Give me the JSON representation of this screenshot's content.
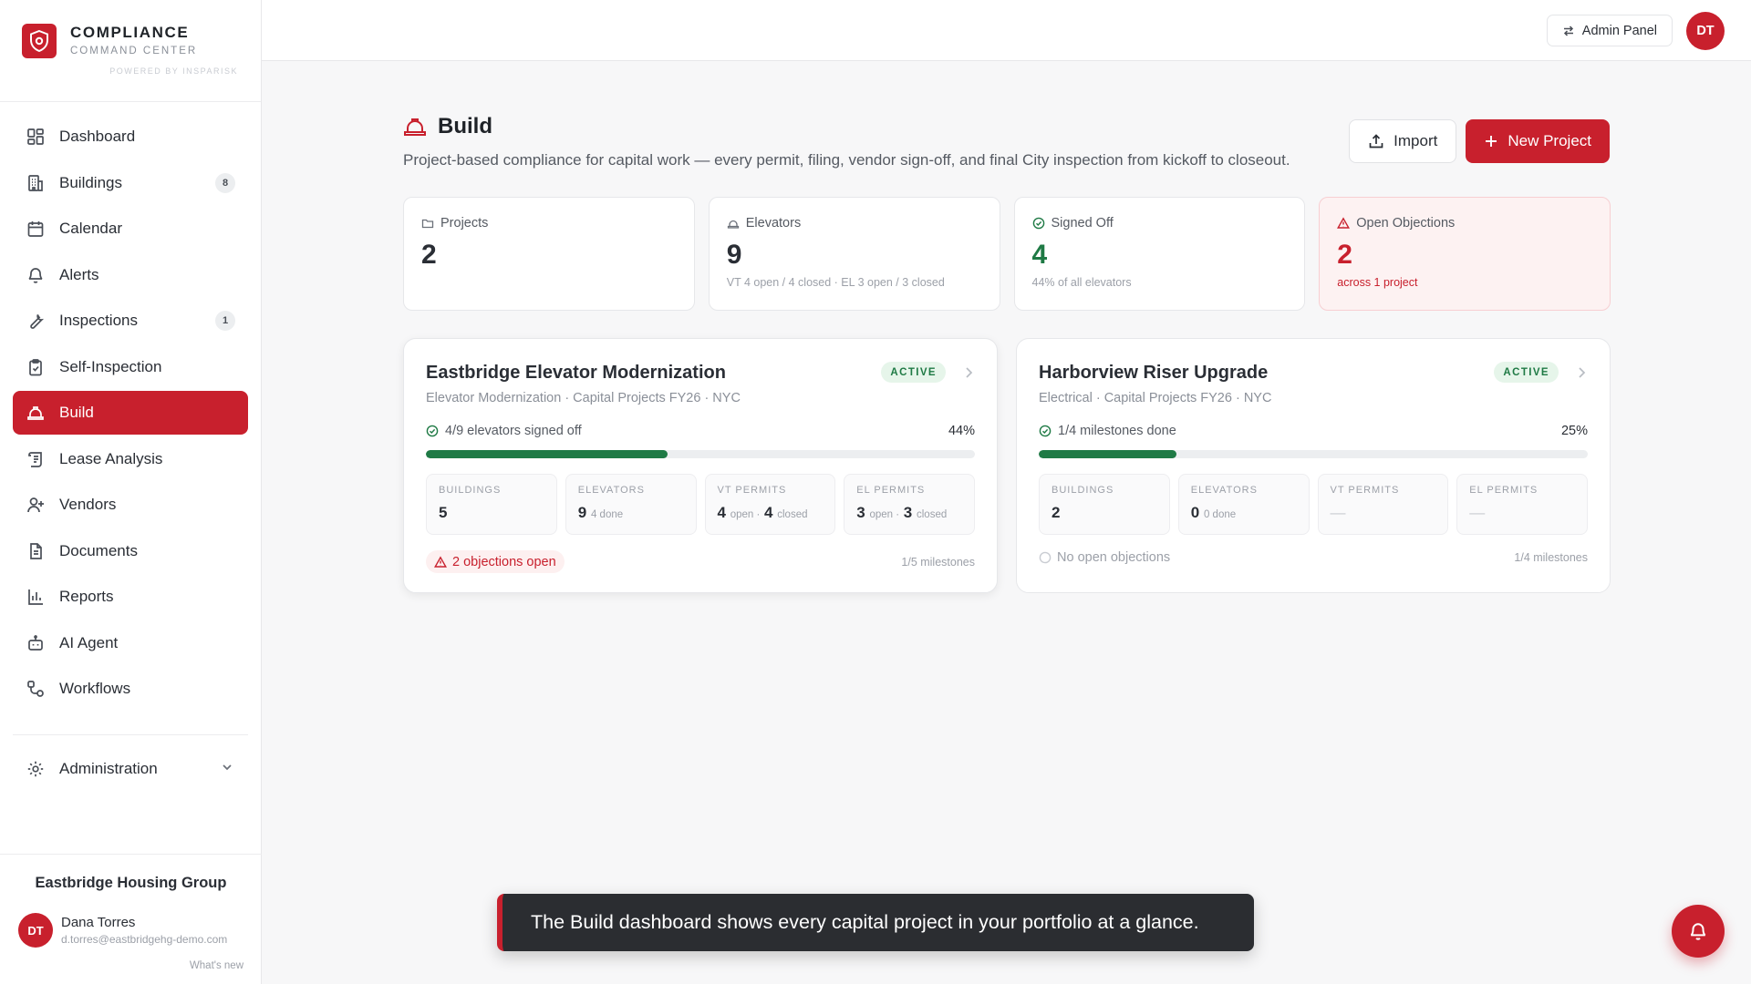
{
  "brand": {
    "title": "COMPLIANCE",
    "subtitle": "COMMAND CENTER",
    "powered": "POWERED BY INSPARISK"
  },
  "nav": {
    "items": [
      {
        "label": "Dashboard",
        "icon": "dashboard-icon"
      },
      {
        "label": "Buildings",
        "icon": "building-icon",
        "badge": "8"
      },
      {
        "label": "Calendar",
        "icon": "calendar-icon"
      },
      {
        "label": "Alerts",
        "icon": "bell-icon"
      },
      {
        "label": "Inspections",
        "icon": "wrench-icon",
        "badge": "1"
      },
      {
        "label": "Self-Inspection",
        "icon": "clipboard-icon"
      },
      {
        "label": "Build",
        "icon": "hardhat-icon",
        "active": true
      },
      {
        "label": "Lease Analysis",
        "icon": "scroll-icon"
      },
      {
        "label": "Vendors",
        "icon": "user-plus-icon"
      },
      {
        "label": "Documents",
        "icon": "document-icon"
      },
      {
        "label": "Reports",
        "icon": "bar-chart-icon"
      },
      {
        "label": "AI Agent",
        "icon": "bot-icon"
      },
      {
        "label": "Workflows",
        "icon": "workflow-icon"
      }
    ],
    "admin_label": "Administration"
  },
  "footer": {
    "org": "Eastbridge Housing Group",
    "user_initials": "DT",
    "user_name": "Dana Torres",
    "user_email": "d.torres@eastbridgehg-demo.com",
    "whats_new": "What's new"
  },
  "topbar": {
    "admin_panel": "Admin Panel",
    "avatar_initials": "DT"
  },
  "page": {
    "title": "Build",
    "description": "Project-based compliance for capital work — every permit, filing, vendor sign-off, and final City inspection from kickoff to closeout.",
    "import_label": "Import",
    "new_project_label": "New Project"
  },
  "stats": [
    {
      "label": "Projects",
      "value": "2",
      "sub": ""
    },
    {
      "label": "Elevators",
      "value": "9",
      "sub": "VT 4 open / 4 closed · EL 3 open / 3 closed"
    },
    {
      "label": "Signed Off",
      "value": "4",
      "sub": "44% of all elevators"
    },
    {
      "label": "Open Objections",
      "value": "2",
      "sub": "across 1 project"
    }
  ],
  "projects": [
    {
      "title": "Eastbridge Elevator Modernization",
      "subtitle": "Elevator Modernization · Capital Projects FY26 · NYC",
      "status": "ACTIVE",
      "progress_label": "4/9 elevators signed off",
      "progress_pct": "44%",
      "progress_value": 0.44,
      "metrics": {
        "buildings": {
          "label": "BUILDINGS",
          "value": "5"
        },
        "elevators": {
          "label": "ELEVATORS",
          "value": "9",
          "small": "4 done"
        },
        "vt": {
          "label": "VT PERMITS",
          "open": "4",
          "open_lbl": "open ·",
          "closed": "4",
          "closed_lbl": "closed"
        },
        "el": {
          "label": "EL PERMITS",
          "open": "3",
          "open_lbl": "open ·",
          "closed": "3",
          "closed_lbl": "closed"
        }
      },
      "objections": "2 objections open",
      "milestones": "1/5 milestones"
    },
    {
      "title": "Harborview Riser Upgrade",
      "subtitle": "Electrical · Capital Projects FY26 · NYC",
      "status": "ACTIVE",
      "progress_label": "1/4 milestones done",
      "progress_pct": "25%",
      "progress_value": 0.25,
      "metrics": {
        "buildings": {
          "label": "BUILDINGS",
          "value": "2"
        },
        "elevators": {
          "label": "ELEVATORS",
          "value": "0",
          "small": "0 done"
        },
        "vt": {
          "label": "VT PERMITS",
          "value": "—"
        },
        "el": {
          "label": "EL PERMITS",
          "value": "—"
        }
      },
      "objections": "No open objections",
      "milestones": "1/4 milestones"
    }
  ],
  "toast": "The Build dashboard shows every capital project in your portfolio at a glance.",
  "colors": {
    "brand": "#c8202d",
    "success": "#1f7a45"
  }
}
